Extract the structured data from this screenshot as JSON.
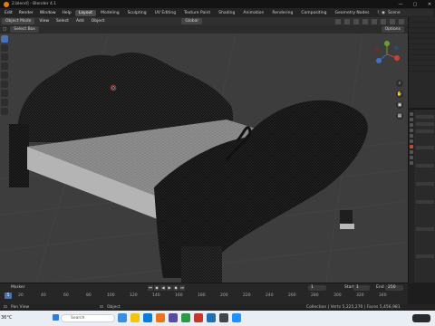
{
  "window": {
    "title": "2.blend] - Blender 4.1",
    "controls": [
      "—",
      "▢",
      "✕"
    ]
  },
  "topbar": {
    "menus": [
      "Edit",
      "Render",
      "Window",
      "Help"
    ],
    "workspaces": [
      "Layout",
      "Modeling",
      "Sculpting",
      "UV Editing",
      "Texture Paint",
      "Shading",
      "Animation",
      "Rendering",
      "Compositing",
      "Geometry Nodes",
      "Scripting"
    ],
    "active_workspace": "Layout",
    "add_tab": "+",
    "scene": "Scene"
  },
  "viewport_header": {
    "mode": "Object Mode",
    "menus": [
      "View",
      "Select",
      "Add",
      "Object"
    ],
    "transform": "Global",
    "select_label": "Select Box",
    "options": "Options"
  },
  "timeline": {
    "marker_label": "Marker",
    "current_frame": "1",
    "start_label": "Start",
    "start": "1",
    "end_label": "End",
    "end": "250",
    "ticks": [
      "5",
      "20",
      "40",
      "60",
      "80",
      "100",
      "120",
      "140",
      "160",
      "180",
      "200",
      "220",
      "240",
      "260",
      "280",
      "300",
      "320",
      "340"
    ],
    "playhead": "5"
  },
  "statusbar": {
    "left": "Pan View",
    "middle": "Object",
    "stats": "Collection | Verts 5,225,270 | Faces 5,456,981"
  },
  "taskbar": {
    "weather": "36°C",
    "search_placeholder": "Search"
  },
  "colors": {
    "accent": "#4772b3",
    "viewport_bg": "#3d3d3d",
    "blender_orange": "#e87d0d"
  }
}
